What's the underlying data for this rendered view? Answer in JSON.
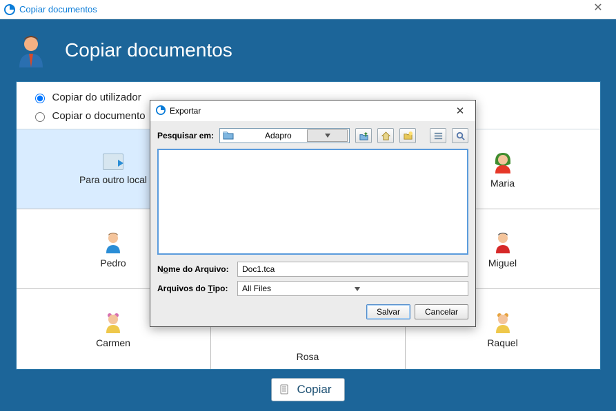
{
  "window": {
    "title": "Copiar documentos"
  },
  "header": {
    "title": "Copiar documentos"
  },
  "options": {
    "opt1": "Copiar do utilizador",
    "opt2": "Copiar o documento",
    "selected": 1
  },
  "grid": {
    "cells": [
      {
        "label": "Para outro local",
        "type": "export",
        "selected": true
      },
      {
        "label": "",
        "type": "empty"
      },
      {
        "label": "Maria",
        "type": "user",
        "hair": "#3f8c2e",
        "shirt": "#e63728"
      },
      {
        "label": "Pedro",
        "type": "user",
        "hair": "#8a5a2b",
        "shirt": "#2a8dd6"
      },
      {
        "label": "",
        "type": "empty"
      },
      {
        "label": "Miguel",
        "type": "user",
        "hair": "#2a2a2a",
        "shirt": "#d62828"
      },
      {
        "label": "Carmen",
        "type": "user",
        "hair": "#d670b0",
        "shirt": "#efc84b"
      },
      {
        "label": "Rosa",
        "type": "label-only"
      },
      {
        "label": "Raquel",
        "type": "user",
        "hair": "#e6a23c",
        "shirt": "#efc84b"
      }
    ]
  },
  "copy_button": "Copiar",
  "dialog": {
    "title": "Exportar",
    "search_in_label": "Pesquisar em:",
    "search_in_value": "Adapro",
    "filename_label_pre": "N",
    "filename_label_u": "o",
    "filename_label_post": "me do Arquivo:",
    "filename_value": "Doc1.tca",
    "filetype_label_pre": "Arquivos do ",
    "filetype_label_u": "T",
    "filetype_label_post": "ipo:",
    "filetype_value": "All Files",
    "save": "Salvar",
    "cancel": "Cancelar"
  }
}
